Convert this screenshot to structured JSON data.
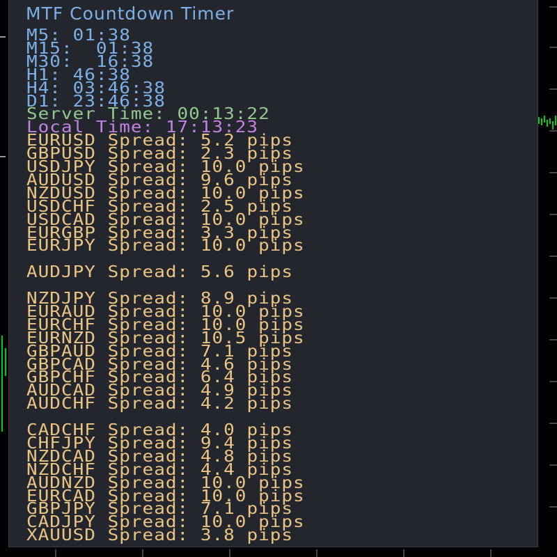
{
  "colors": {
    "panel_bg": "#24262d",
    "title": "#7cb0e8",
    "timeframe_text": "#7cb0e8",
    "server_time_text": "#92c98e",
    "local_time_text": "#c282e3",
    "spread_text": "#ebc383",
    "chart_candle": "#00d000"
  },
  "panel": {
    "title": "MTF Countdown Timer",
    "timeframes": [
      {
        "label": "M5:",
        "value": "01:38"
      },
      {
        "label": "M15:",
        "value": " 01:38"
      },
      {
        "label": "M30:",
        "value": " 16:38"
      },
      {
        "label": "H1:",
        "value": "46:38"
      },
      {
        "label": "H4:",
        "value": "03:46:38"
      },
      {
        "label": "D1:",
        "value": "23:46:38"
      }
    ],
    "server_time": {
      "label": "Server Time:",
      "value": "00:13:22"
    },
    "local_time": {
      "label": "Local Time:",
      "value": "17:13:23"
    },
    "spread_word": "Spread:",
    "unit": "pips",
    "spread_groups": [
      [
        {
          "symbol": "EURUSD",
          "value": "5.2"
        },
        {
          "symbol": "GBPUSD",
          "value": "2.3"
        },
        {
          "symbol": "USDJPY",
          "value": "10.0"
        },
        {
          "symbol": "AUDUSD",
          "value": "9.6"
        },
        {
          "symbol": "NZDUSD",
          "value": "10.0"
        },
        {
          "symbol": "USDCHF",
          "value": "2.5"
        },
        {
          "symbol": "USDCAD",
          "value": "10.0"
        },
        {
          "symbol": "EURGBP",
          "value": "3.3"
        },
        {
          "symbol": "EURJPY",
          "value": "10.0"
        }
      ],
      [
        {
          "symbol": "AUDJPY",
          "value": "5.6"
        }
      ],
      [
        {
          "symbol": "NZDJPY",
          "value": "8.9"
        },
        {
          "symbol": "EURAUD",
          "value": "10.0"
        },
        {
          "symbol": "EURCHF",
          "value": "10.0"
        },
        {
          "symbol": "EURNZD",
          "value": "10.5"
        },
        {
          "symbol": "GBPAUD",
          "value": "7.1"
        },
        {
          "symbol": "GBPCAD",
          "value": "4.6"
        },
        {
          "symbol": "GBPCHF",
          "value": "6.4"
        },
        {
          "symbol": "AUDCAD",
          "value": "4.9"
        },
        {
          "symbol": "AUDCHF",
          "value": "4.2"
        }
      ],
      [
        {
          "symbol": "CADCHF",
          "value": "4.0"
        },
        {
          "symbol": "CHFJPY",
          "value": "9.4"
        },
        {
          "symbol": "NZDCAD",
          "value": "4.8"
        },
        {
          "symbol": "NZDCHF",
          "value": "4.4"
        },
        {
          "symbol": "AUDNZD",
          "value": "10.0"
        },
        {
          "symbol": "EURCAD",
          "value": "10.0"
        },
        {
          "symbol": "GBPJPY",
          "value": "7.1"
        },
        {
          "symbol": "CADJPY",
          "value": "10.0"
        },
        {
          "symbol": "XAUUSD",
          "value": "3.8"
        }
      ]
    ]
  }
}
